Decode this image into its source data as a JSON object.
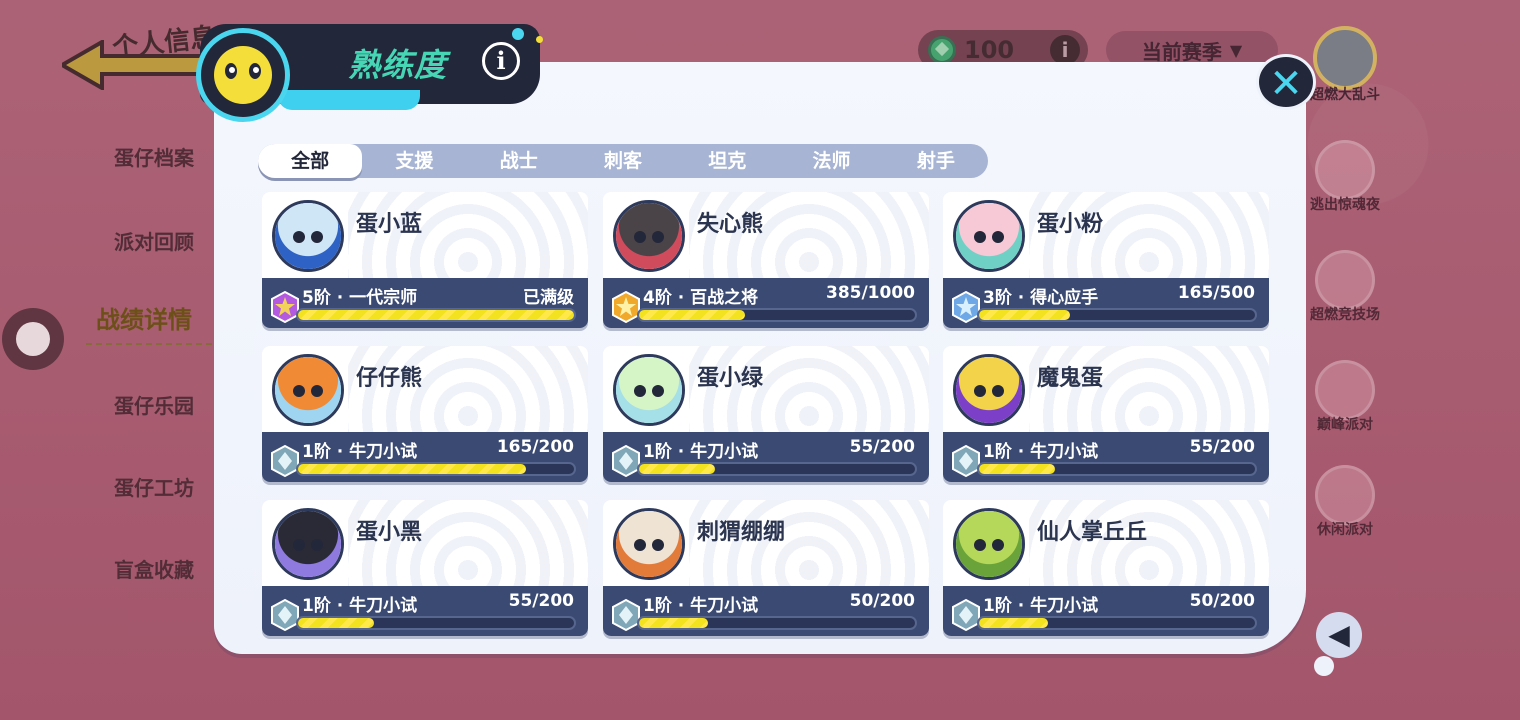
{
  "background": {
    "back_title": "个人信息",
    "menu": [
      {
        "label": "蛋仔档案",
        "active": false
      },
      {
        "label": "派对回顾",
        "active": false
      },
      {
        "label": "战绩详情",
        "active": true
      },
      {
        "label": "蛋仔乐园",
        "active": false
      },
      {
        "label": "蛋仔工坊",
        "active": false
      },
      {
        "label": "盲盒收藏",
        "active": false
      }
    ],
    "currency_value": "100",
    "season_label": "当前赛季",
    "modes": [
      {
        "label": "超燃大乱斗"
      },
      {
        "label": "逃出惊魂夜"
      },
      {
        "label": "超燃竞技场"
      },
      {
        "label": "巅峰派对"
      },
      {
        "label": "休闲派对"
      }
    ]
  },
  "panel": {
    "title": "熟练度",
    "tabs": [
      {
        "label": "全部",
        "active": true
      },
      {
        "label": "支援",
        "active": false
      },
      {
        "label": "战士",
        "active": false
      },
      {
        "label": "刺客",
        "active": false
      },
      {
        "label": "坦克",
        "active": false
      },
      {
        "label": "法师",
        "active": false
      },
      {
        "label": "射手",
        "active": false
      }
    ],
    "characters": [
      {
        "name": "蛋小蓝",
        "rank": "5阶 · 一代宗师",
        "progress": "已满级",
        "fill": 1.0,
        "tier": "purple",
        "avatar": "#cfe6f6",
        "avatar2": "#2e62c4"
      },
      {
        "name": "失心熊",
        "rank": "4阶 · 百战之将",
        "progress": "385/1000",
        "fill": 0.385,
        "tier": "gold",
        "avatar": "#4a4348",
        "avatar2": "#d04b5c"
      },
      {
        "name": "蛋小粉",
        "rank": "3阶 · 得心应手",
        "progress": "165/500",
        "fill": 0.33,
        "tier": "blue",
        "avatar": "#f7c9d6",
        "avatar2": "#6fd1c6"
      },
      {
        "name": "仔仔熊",
        "rank": "1阶 · 牛刀小试",
        "progress": "165/200",
        "fill": 0.825,
        "tier": "silver",
        "avatar": "#f08a35",
        "avatar2": "#9fd5f0"
      },
      {
        "name": "蛋小绿",
        "rank": "1阶 · 牛刀小试",
        "progress": "55/200",
        "fill": 0.275,
        "tier": "silver",
        "avatar": "#d6f5c6",
        "avatar2": "#a5dfe7"
      },
      {
        "name": "魔鬼蛋",
        "rank": "1阶 · 牛刀小试",
        "progress": "55/200",
        "fill": 0.275,
        "tier": "silver",
        "avatar": "#f2d34a",
        "avatar2": "#7c3fc7"
      },
      {
        "name": "蛋小黑",
        "rank": "1阶 · 牛刀小试",
        "progress": "55/200",
        "fill": 0.275,
        "tier": "silver",
        "avatar": "#2a2a36",
        "avatar2": "#8f7ae0"
      },
      {
        "name": "刺猬绷绷",
        "rank": "1阶 · 牛刀小试",
        "progress": "50/200",
        "fill": 0.25,
        "tier": "silver",
        "avatar": "#efe3d4",
        "avatar2": "#e27a3a"
      },
      {
        "name": "仙人掌丘丘",
        "rank": "1阶 · 牛刀小试",
        "progress": "50/200",
        "fill": 0.25,
        "tier": "silver",
        "avatar": "#b6d85a",
        "avatar2": "#6aa33a"
      }
    ]
  },
  "colors": {
    "accent": "#4ad6ee",
    "title": "#47d6b5",
    "dark": "#23273a",
    "bar": "#f3e21f",
    "card_bottom": "#3b4a72"
  }
}
